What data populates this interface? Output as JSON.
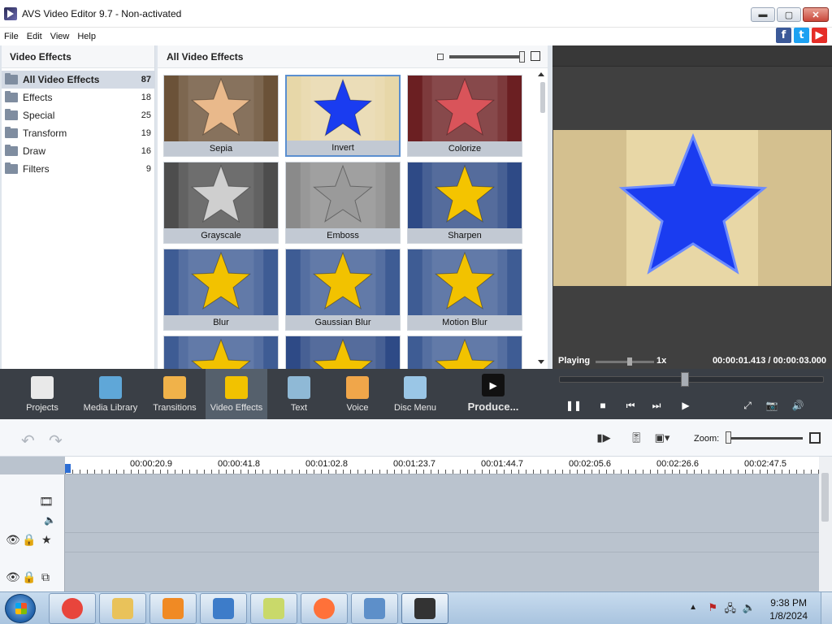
{
  "window": {
    "title": "AVS Video Editor 9.7 - Non-activated",
    "buttons": {
      "minimize": "▬",
      "maximize": "▢",
      "close": "✕"
    }
  },
  "menu": [
    "File",
    "Edit",
    "View",
    "Help"
  ],
  "social": [
    {
      "name": "facebook-icon",
      "glyph": "f",
      "color": "#3b5998"
    },
    {
      "name": "twitter-icon",
      "glyph": "t",
      "color": "#1da1f2"
    },
    {
      "name": "youtube-icon",
      "glyph": "▶",
      "color": "#e52d27"
    }
  ],
  "left_panel": {
    "header": "Video Effects",
    "categories": [
      {
        "label": "All Video Effects",
        "count": "87",
        "selected": true
      },
      {
        "label": "Effects",
        "count": "18"
      },
      {
        "label": "Special",
        "count": "25"
      },
      {
        "label": "Transform",
        "count": "19"
      },
      {
        "label": "Draw",
        "count": "16"
      },
      {
        "label": "Filters",
        "count": "9"
      }
    ]
  },
  "gallery": {
    "header": "All Video Effects",
    "tiles": [
      {
        "label": "Sepia",
        "bg": "#6b5238",
        "star": "#e9b98b",
        "selected": false
      },
      {
        "label": "Invert",
        "bg": "#e7d7a8",
        "star": "#1a3cf0",
        "selected": true
      },
      {
        "label": "Colorize",
        "bg": "#6b1f22",
        "star": "#d9545a",
        "selected": false
      },
      {
        "label": "Grayscale",
        "bg": "#4d4d4d",
        "star": "#cfcfcf",
        "selected": false
      },
      {
        "label": "Emboss",
        "bg": "#8a8a8a",
        "star": "#9a9a9a",
        "selected": false
      },
      {
        "label": "Sharpen",
        "bg": "#2e4a86",
        "star": "#f4c400",
        "selected": false
      },
      {
        "label": "Blur",
        "bg": "#3e5c94",
        "star": "#f2c200",
        "selected": false
      },
      {
        "label": "Gaussian Blur",
        "bg": "#3e5c94",
        "star": "#f2c200",
        "selected": false
      },
      {
        "label": "Motion Blur",
        "bg": "#3e5c94",
        "star": "#f2c200",
        "selected": false
      },
      {
        "label": "",
        "bg": "#3e5c94",
        "star": "#f2c200",
        "selected": false
      },
      {
        "label": "",
        "bg": "#2e4a86",
        "star": "#f2c200",
        "selected": false
      },
      {
        "label": "",
        "bg": "#3e5c94",
        "star": "#f2c200",
        "selected": false
      }
    ]
  },
  "preview": {
    "status": "Playing",
    "speed": "1x",
    "time": "00:00:01.413 / 00:00:03.000",
    "bg": "#e8d7a6",
    "star": "#1a3cf0"
  },
  "toolbar": {
    "items": [
      {
        "label": "Projects",
        "icon": "clapper-icon",
        "color": "#e9e9e9"
      },
      {
        "label": "Media Library",
        "icon": "film-icon",
        "color": "#5fa7d8"
      },
      {
        "label": "Transitions",
        "icon": "transition-icon",
        "color": "#f0b24a"
      },
      {
        "label": "Video Effects",
        "icon": "star-effect-icon",
        "color": "#f2c200",
        "active": true
      },
      {
        "label": "Text",
        "icon": "text-icon",
        "color": "#8fb9d6"
      },
      {
        "label": "Voice",
        "icon": "microphone-icon",
        "color": "#f0a64a"
      },
      {
        "label": "Disc Menu",
        "icon": "disc-icon",
        "color": "#9ac6e6"
      }
    ],
    "produce": "Produce...",
    "playback": [
      {
        "name": "pause-button",
        "glyph": "❚❚"
      },
      {
        "name": "stop-button",
        "glyph": "■"
      },
      {
        "name": "previous-frame-button",
        "glyph": "⏮"
      },
      {
        "name": "next-frame-button",
        "glyph": "⏭"
      },
      {
        "name": "play-selection-button",
        "glyph": "▶"
      },
      {
        "name": "fullscreen-button",
        "glyph": "⤢"
      },
      {
        "name": "snapshot-button",
        "glyph": "📷"
      },
      {
        "name": "volume-button",
        "glyph": "🔊"
      }
    ],
    "seek_fraction": 0.47
  },
  "timeline_toolbar": {
    "undo": "↶",
    "redo": "↷",
    "zoom_label": "Zoom:"
  },
  "timeline": {
    "ruler": [
      "00:00:20.9",
      "00:00:41.8",
      "00:01:02.8",
      "00:01:23.7",
      "00:01:44.7",
      "00:02:05.6",
      "00:02:26.6",
      "00:02:47.5"
    ]
  },
  "taskbar": {
    "apps": [
      {
        "name": "chrome-icon"
      },
      {
        "name": "file-explorer-icon"
      },
      {
        "name": "media-player-icon"
      },
      {
        "name": "network-icon"
      },
      {
        "name": "sticky-notes-icon"
      },
      {
        "name": "firefox-icon"
      },
      {
        "name": "keyboard-app-icon"
      },
      {
        "name": "avs-editor-icon",
        "active": true
      }
    ],
    "time": "9:38 PM",
    "date": "1/8/2024"
  }
}
